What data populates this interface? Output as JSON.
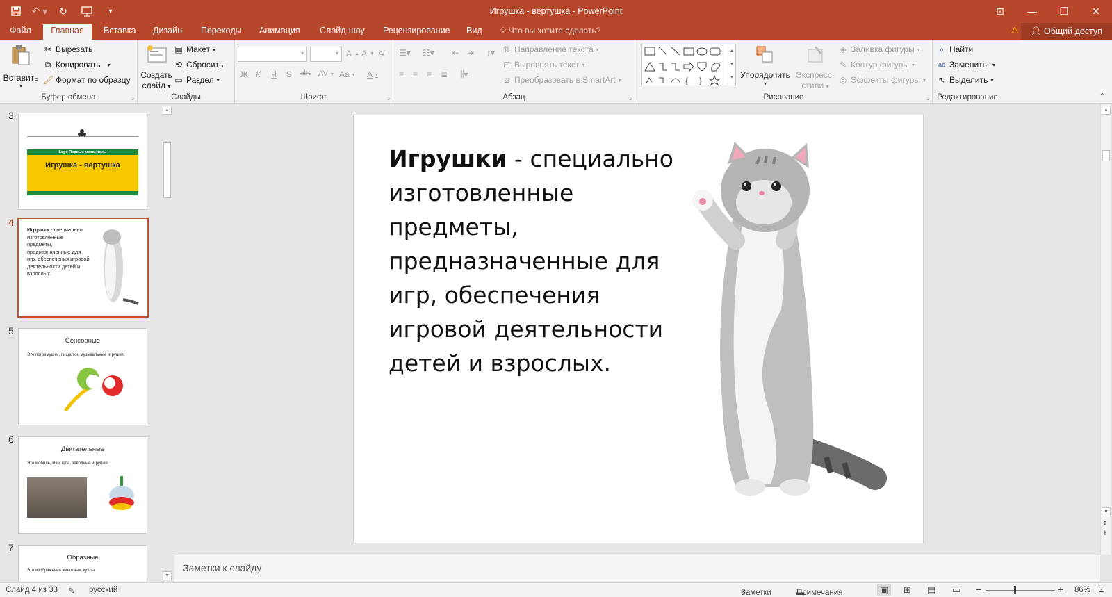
{
  "window": {
    "title": "Игрушка - вертушка - PowerPoint",
    "accent": "#b7472a"
  },
  "tabs": [
    {
      "label": "Файл"
    },
    {
      "label": "Главная",
      "active": true
    },
    {
      "label": "Вставка"
    },
    {
      "label": "Дизайн"
    },
    {
      "label": "Переходы"
    },
    {
      "label": "Анимация"
    },
    {
      "label": "Слайд-шоу"
    },
    {
      "label": "Рецензирование"
    },
    {
      "label": "Вид"
    }
  ],
  "tell_me": "Что вы хотите сделать?",
  "share_label": "Общий доступ",
  "ribbon": {
    "clipboard": {
      "paste": "Вставить",
      "cut": "Вырезать",
      "copy": "Копировать",
      "format_painter": "Формат по образцу",
      "label": "Буфер обмена"
    },
    "slides": {
      "new_slide_1": "Создать",
      "new_slide_2": "слайд",
      "layout": "Макет",
      "reset": "Сбросить",
      "section": "Раздел",
      "label": "Слайды"
    },
    "font": {
      "label": "Шрифт",
      "bold": "Ж",
      "italic": "К",
      "underline": "Ч",
      "shadow": "S",
      "strike": "abc",
      "spacing": "AV",
      "case": "Aa",
      "color": "A"
    },
    "paragraph": {
      "text_direction": "Направление текста",
      "align_text": "Выровнять текст",
      "smartart": "Преобразовать в SmartArt",
      "label": "Абзац"
    },
    "drawing": {
      "arrange": "Упорядочить",
      "quick_styles_1": "Экспресс-",
      "quick_styles_2": "стили",
      "fill": "Заливка фигуры",
      "outline": "Контур фигуры",
      "effects": "Эффекты фигуры",
      "label": "Рисование"
    },
    "editing": {
      "find": "Найти",
      "replace": "Заменить",
      "select": "Выделить",
      "label": "Редактирование"
    }
  },
  "thumbnails": [
    {
      "num": "3",
      "banner_top": "Lego Первые механизмы",
      "banner_title": "Игрушка - вертушка"
    },
    {
      "num": "4",
      "text_bold": "Игрушки",
      "text_rest": " - специально изготовленные предметы, предназначенные для игр, обеспечения игровой деятельности детей и взрослых."
    },
    {
      "num": "5",
      "title": "Сенсорные",
      "text": "Это погремушки, пищалки, музыкальные игрушки."
    },
    {
      "num": "6",
      "title": "Двигательные",
      "text": "Это мобиль, мяч, юла, заводные игрушки."
    },
    {
      "num": "7",
      "title": "Образные",
      "text": "Это изображения животных, куклы"
    }
  ],
  "slide": {
    "bold": "Игрушки",
    "rest": " - специально изготовленные предметы, предназначенные для игр, обеспечения игровой деятельности детей и взрослых."
  },
  "notes_placeholder": "Заметки к слайду",
  "status": {
    "slide_counter": "Слайд 4 из 33",
    "language": "русский",
    "notes": "Заметки",
    "comments": "Примечания",
    "zoom": "86%",
    "zoom_level": 0.86
  }
}
